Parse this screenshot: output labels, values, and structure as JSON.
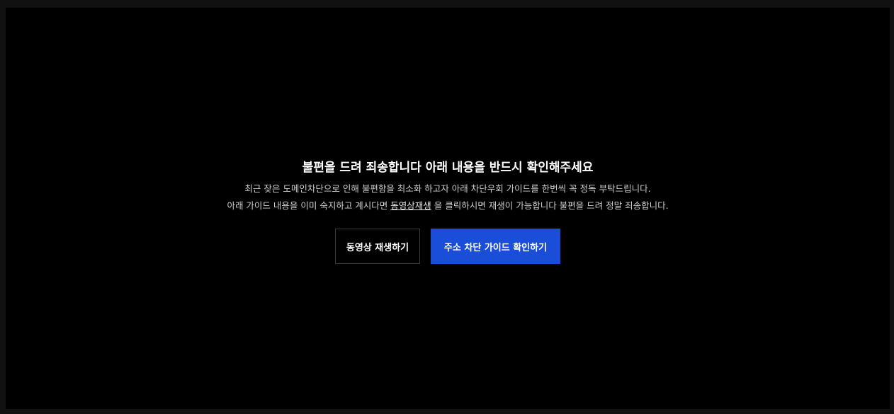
{
  "notice": {
    "title": "불편을 드려 죄송합니다 아래 내용을 반드시 확인해주세요",
    "line1": "최근 잦은 도메인차단으로 인해 불편함을 최소화 하고자 아래 차단우회 가이드를 한번씩 꼭 정독 부탁드립니다.",
    "line2_prefix": "아래 가이드 내용을 이미 숙지하고 계시다면 ",
    "line2_link": "동영상재생",
    "line2_suffix": " 을 클릭하시면 재생이 가능합니다 불편을 드려 정말 죄송합니다."
  },
  "buttons": {
    "play_label": "동영상 재생하기",
    "guide_label": "주소 차단 가이드 확인하기"
  },
  "colors": {
    "background": "#000000",
    "outer": "#111111",
    "accent": "#1a4ed8"
  }
}
